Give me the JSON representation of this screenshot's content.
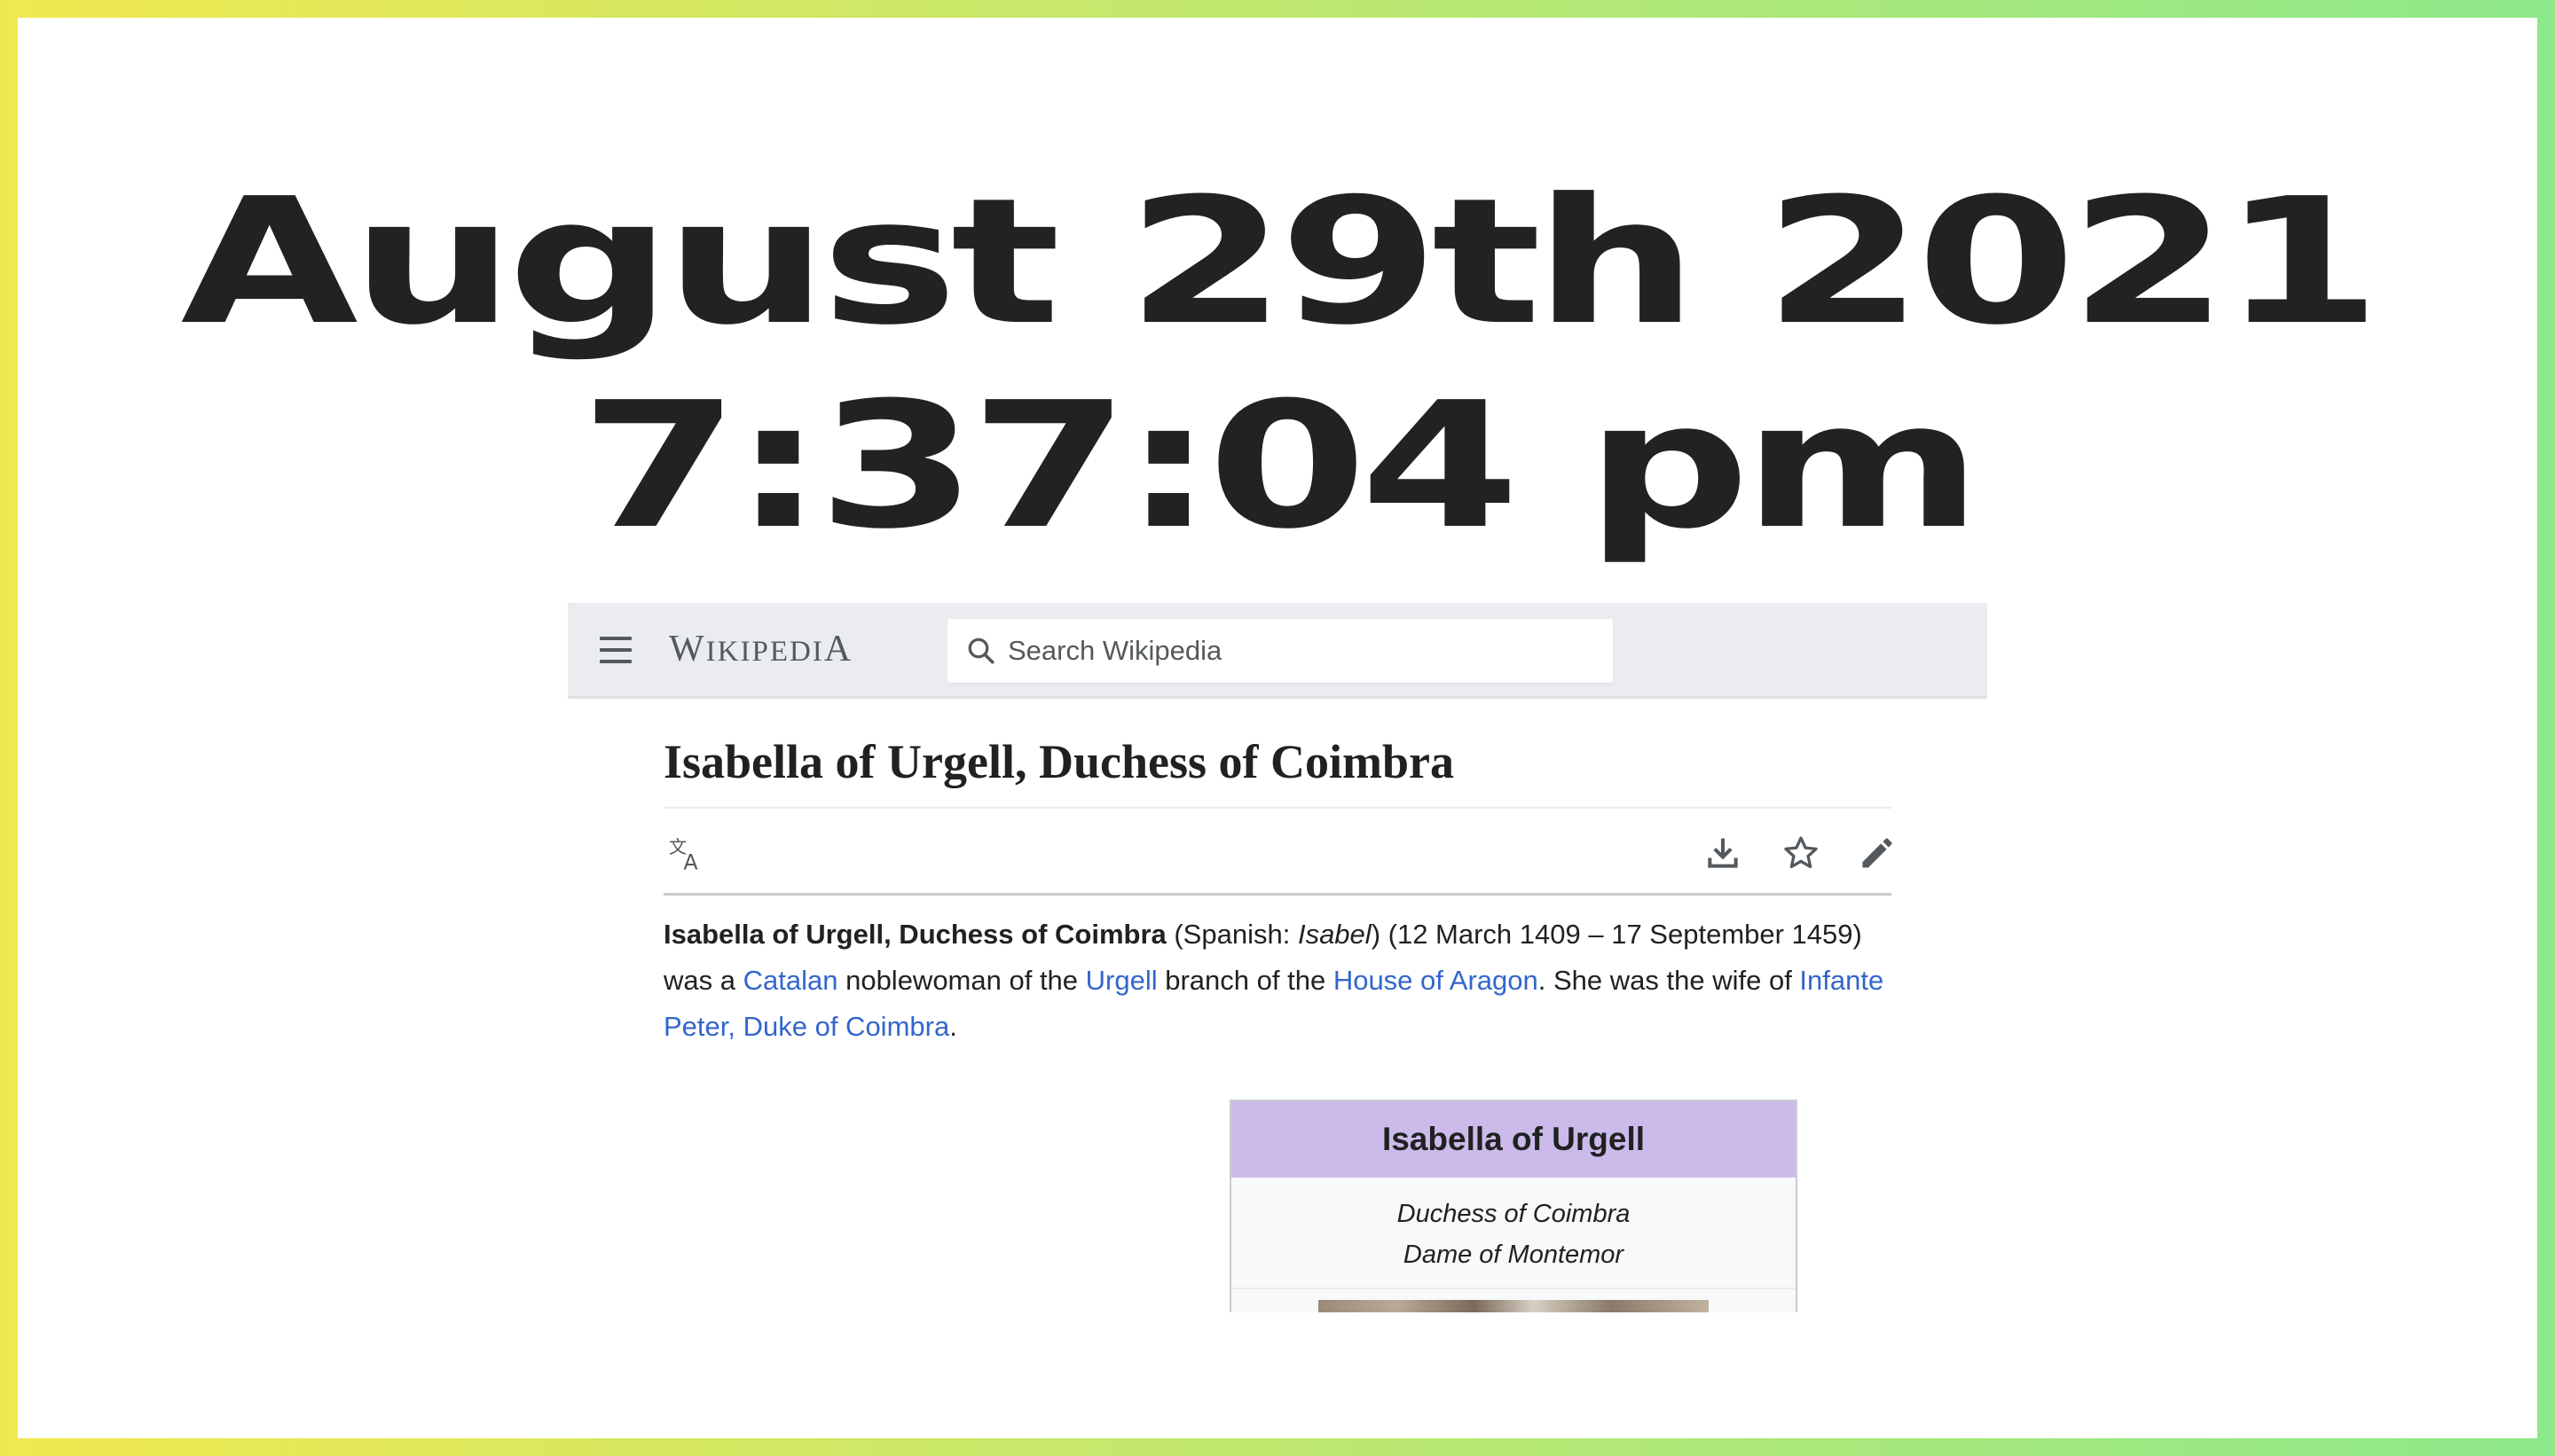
{
  "clock": {
    "date": "August 29th 2021",
    "time": "7:37:04 pm"
  },
  "header": {
    "wordmark_initial": "W",
    "wordmark_rest": "IKIPEDI",
    "wordmark_end": "A",
    "search_placeholder": "Search Wikipedia"
  },
  "article": {
    "title": "Isabella of Urgell, Duchess of Coimbra",
    "lead": {
      "subject": "Isabella of Urgell, Duchess of Coimbra",
      "t1": " (Spanish: ",
      "spanish_name": "Isabel",
      "t2": ") (12 March 1409 – 17 September 1459) was a ",
      "link_catalan": "Catalan",
      "t3": " noblewoman of the ",
      "link_urgell": "Urgell",
      "t4": " branch of the ",
      "link_aragon": "House of Aragon",
      "t5": ". She was the wife of ",
      "link_peter": "Infante Peter, Duke of Coimbra",
      "t6": "."
    }
  },
  "infobox": {
    "title": "Isabella of Urgell",
    "subtitle_1": "Duchess of Coimbra",
    "subtitle_2": "Dame of Montemor"
  },
  "icons": [
    "menu-icon",
    "search-icon",
    "language-icon",
    "download-icon",
    "star-icon",
    "edit-icon"
  ],
  "colors": {
    "link": "#3366cc",
    "infobox_header": "#ccbbea",
    "clock_text": "#222222"
  }
}
